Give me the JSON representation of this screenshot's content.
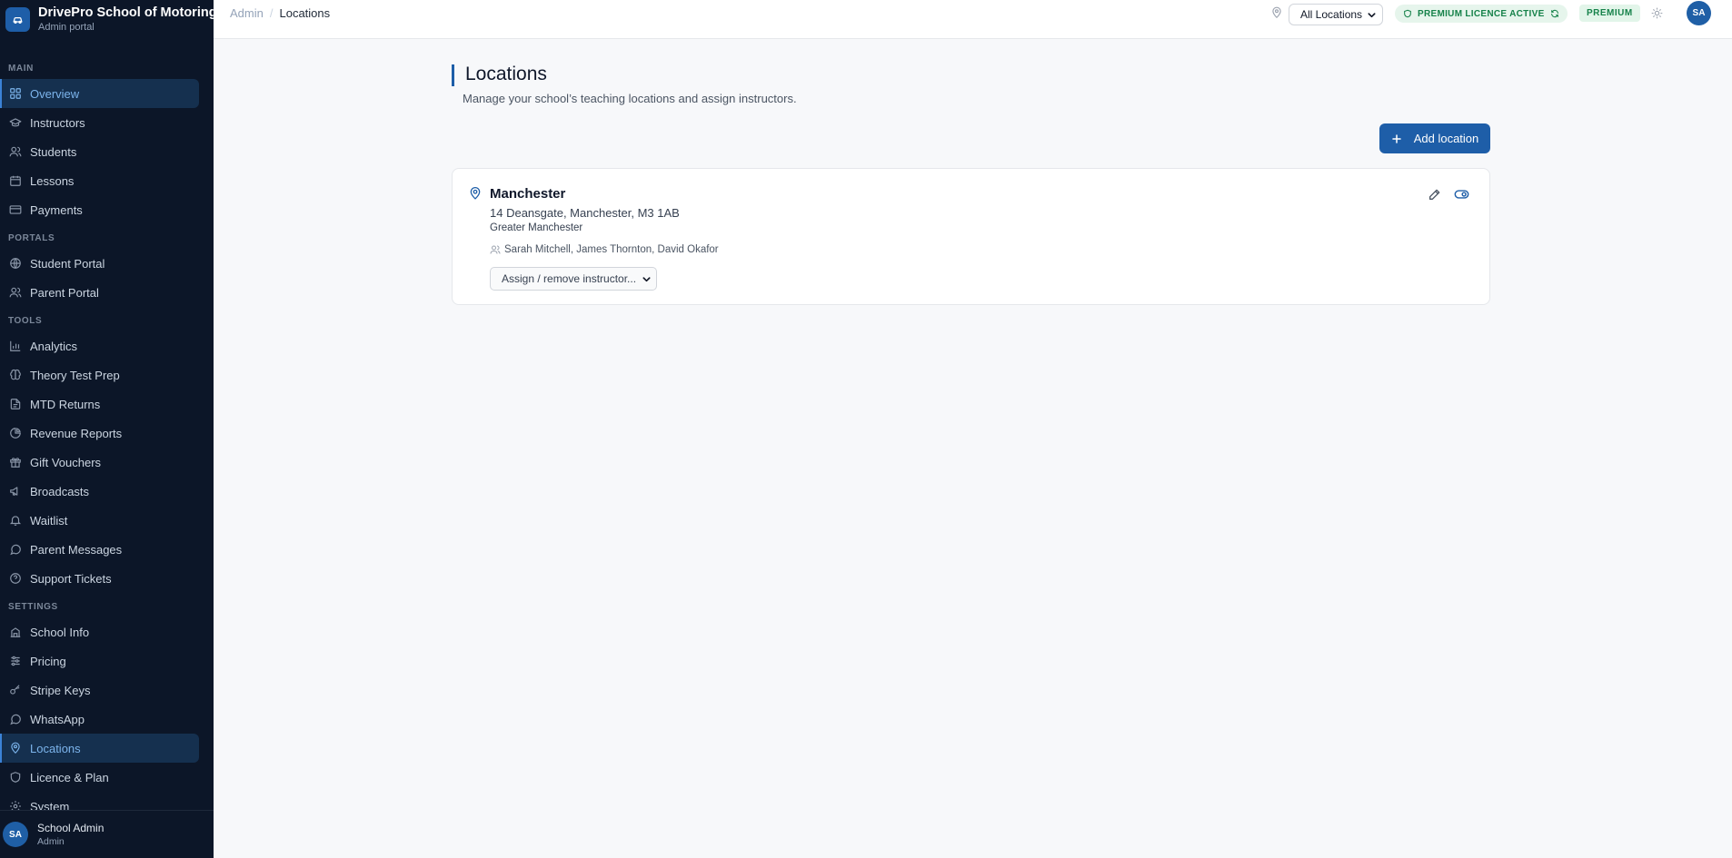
{
  "brand": {
    "title": "DrivePro School of Motoring",
    "subtitle": "Admin portal"
  },
  "sidebar": {
    "sections": [
      {
        "label": "MAIN",
        "items": [
          {
            "label": "Overview",
            "icon": "grid-icon"
          },
          {
            "label": "Instructors",
            "icon": "graduation-cap-icon"
          },
          {
            "label": "Students",
            "icon": "users-icon"
          },
          {
            "label": "Lessons",
            "icon": "calendar-icon"
          },
          {
            "label": "Payments",
            "icon": "credit-card-icon"
          }
        ]
      },
      {
        "label": "PORTALS",
        "items": [
          {
            "label": "Student Portal",
            "icon": "globe-icon"
          },
          {
            "label": "Parent Portal",
            "icon": "users-icon"
          }
        ]
      },
      {
        "label": "TOOLS",
        "items": [
          {
            "label": "Analytics",
            "icon": "bar-chart-icon"
          },
          {
            "label": "Theory Test Prep",
            "icon": "brain-icon"
          },
          {
            "label": "MTD Returns",
            "icon": "file-text-icon"
          },
          {
            "label": "Revenue Reports",
            "icon": "pie-chart-icon"
          },
          {
            "label": "Gift Vouchers",
            "icon": "gift-icon"
          },
          {
            "label": "Broadcasts",
            "icon": "megaphone-icon"
          },
          {
            "label": "Waitlist",
            "icon": "bell-icon"
          },
          {
            "label": "Parent Messages",
            "icon": "message-circle-icon"
          },
          {
            "label": "Support Tickets",
            "icon": "help-circle-icon"
          }
        ]
      },
      {
        "label": "SETTINGS",
        "items": [
          {
            "label": "School Info",
            "icon": "building-icon"
          },
          {
            "label": "Pricing",
            "icon": "sliders-icon"
          },
          {
            "label": "Stripe Keys",
            "icon": "key-icon"
          },
          {
            "label": "WhatsApp",
            "icon": "message-circle-icon"
          },
          {
            "label": "Locations",
            "icon": "map-pin-icon"
          },
          {
            "label": "Licence & Plan",
            "icon": "shield-icon"
          },
          {
            "label": "System",
            "icon": "gear-icon"
          }
        ]
      }
    ],
    "active_item": "Locations",
    "highlighted_item": "Overview"
  },
  "user": {
    "initials": "SA",
    "name": "School Admin",
    "role": "Admin"
  },
  "header": {
    "breadcrumb_root": "Admin",
    "breadcrumb_sep": "/",
    "breadcrumb_current": "Locations",
    "location_filter": "All Locations",
    "licence_status": "PREMIUM LICENCE ACTIVE",
    "plan_badge": "PREMIUM",
    "avatar_initials": "SA"
  },
  "page": {
    "title": "Locations",
    "subtitle": "Manage your school’s teaching locations and assign instructors.",
    "add_button": "Add location"
  },
  "locations": [
    {
      "name": "Manchester",
      "address": "14 Deansgate, Manchester, M3 1AB",
      "region": "Greater Manchester",
      "instructors": "Sarah Mitchell, James Thornton, David Okafor",
      "assign_placeholder": "Assign / remove instructor..."
    }
  ],
  "colors": {
    "sidebar_bg": "#0c1628",
    "accent": "#1e5ea8",
    "active_text": "#7cb4ec",
    "licence_green": "#16824a",
    "page_bg": "#f7f8fa"
  }
}
